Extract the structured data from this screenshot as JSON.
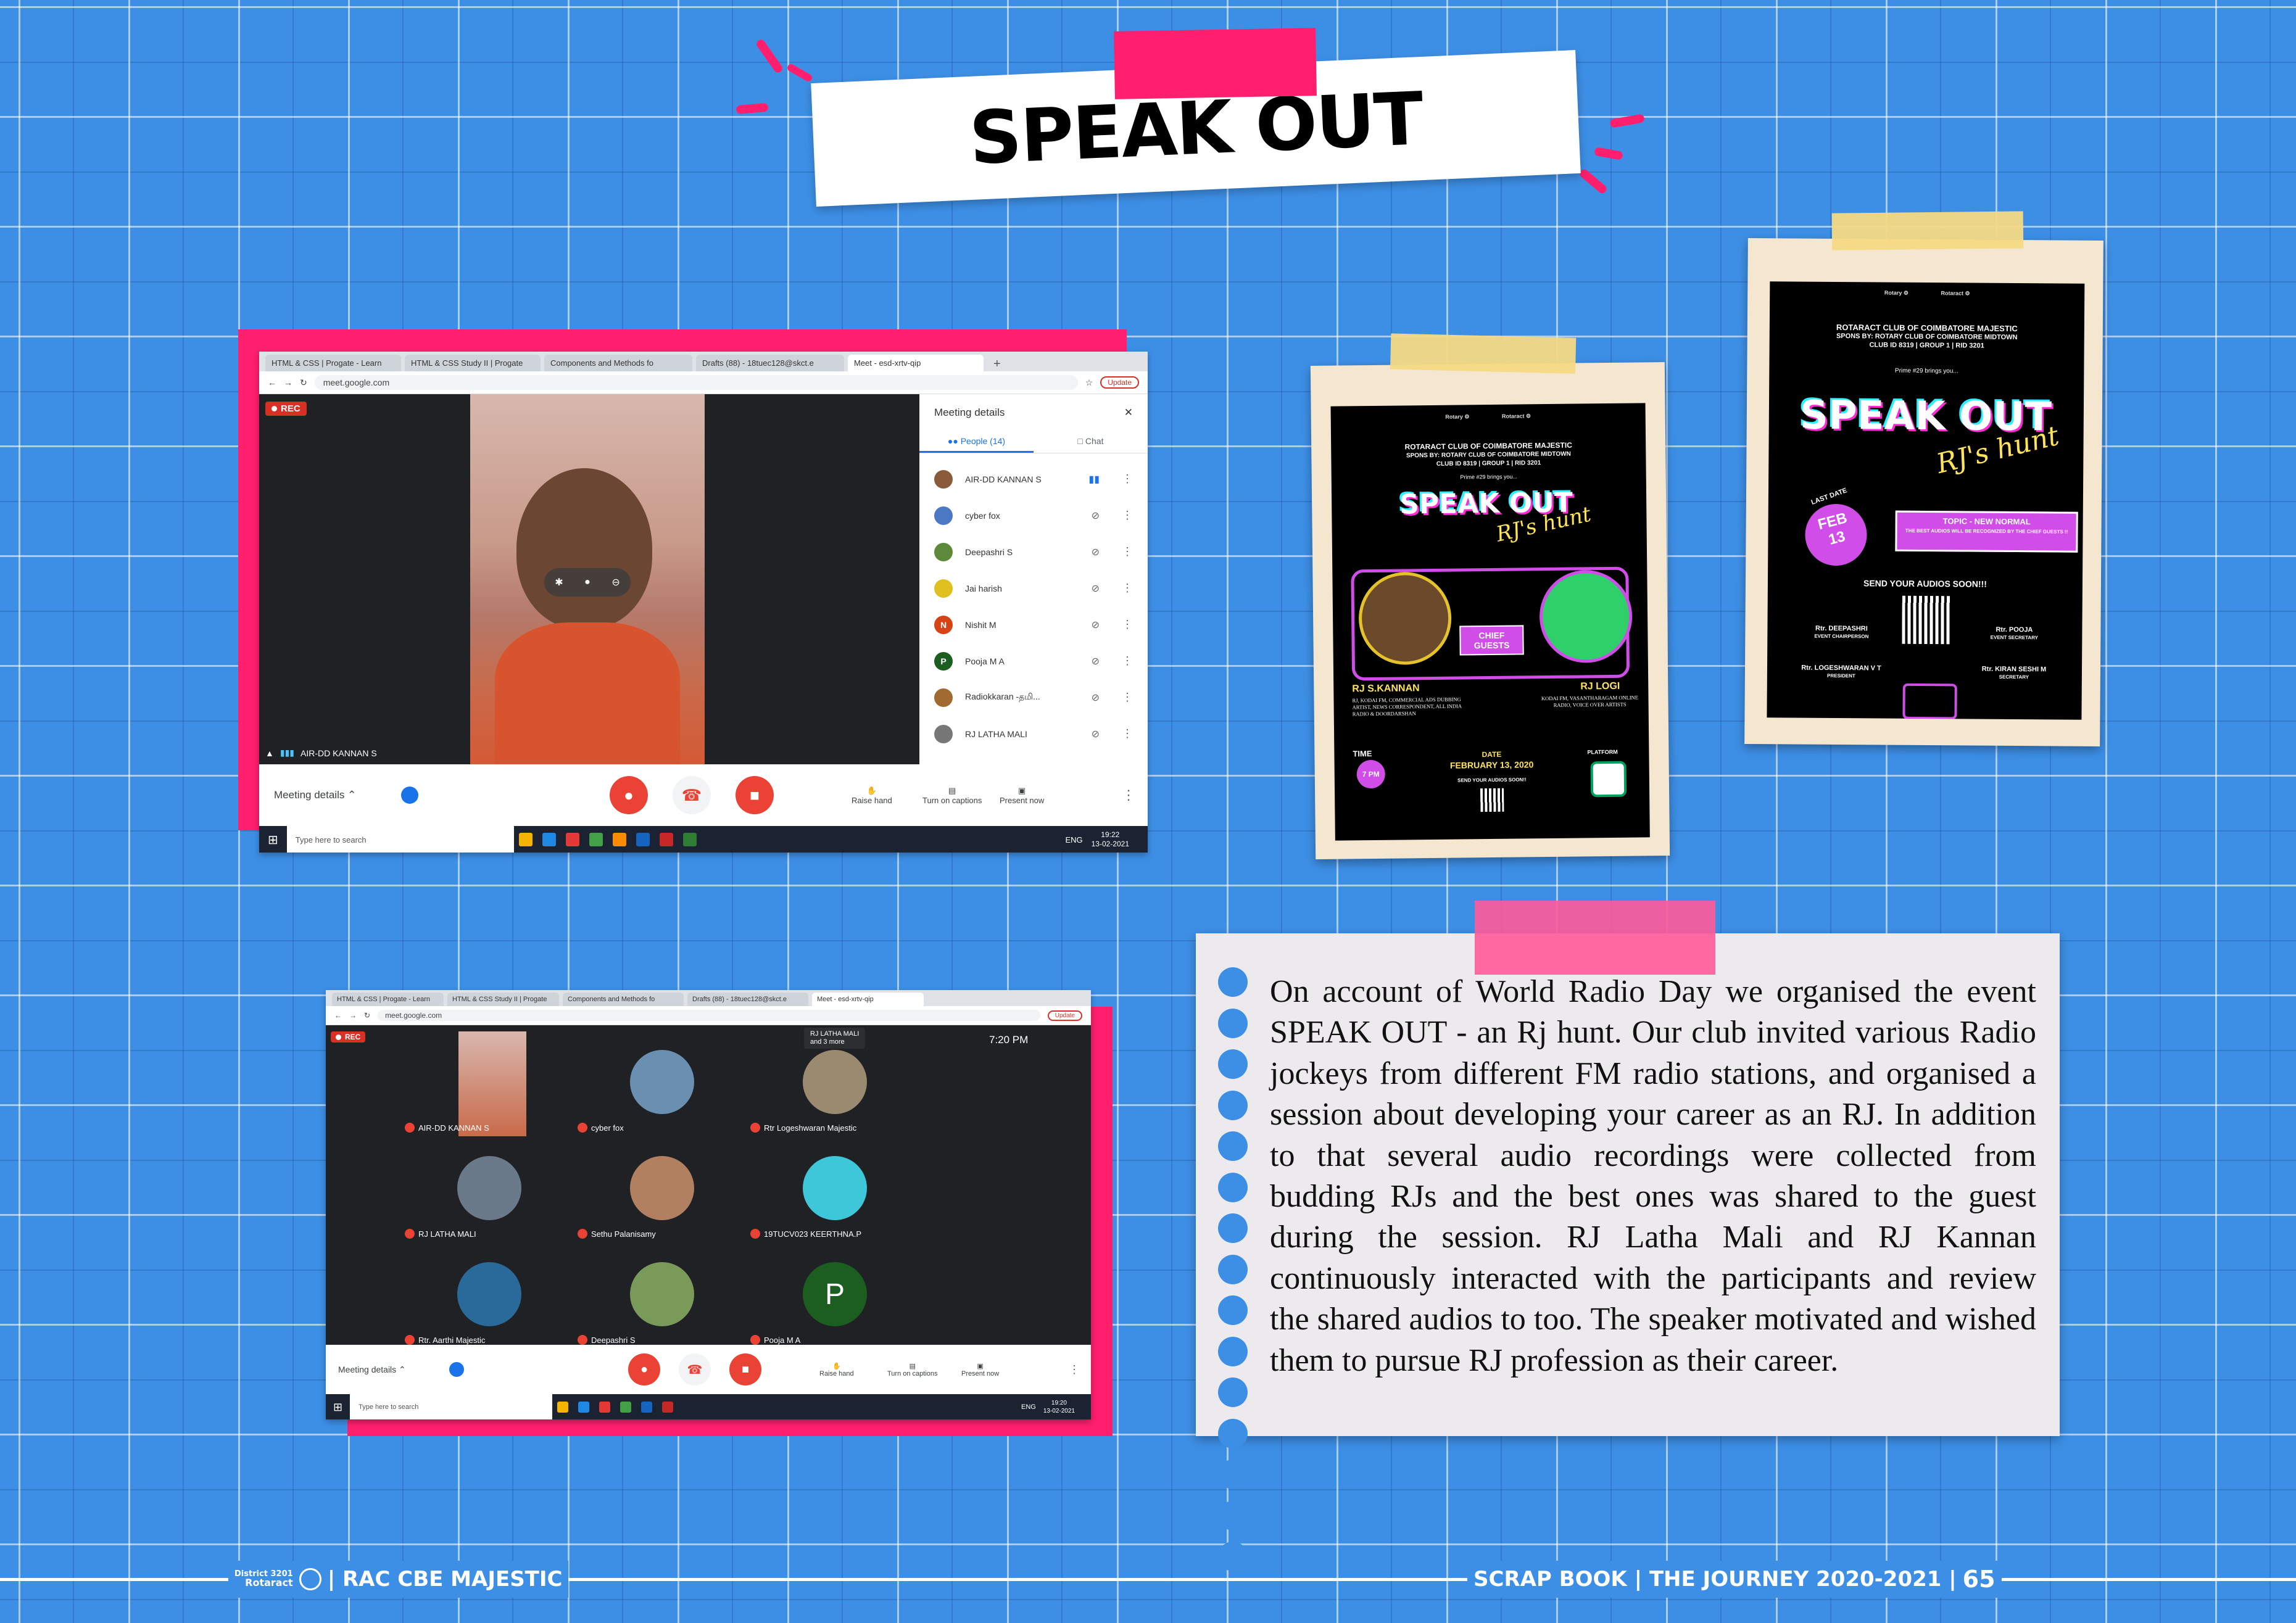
{
  "title": "SPEAK OUT",
  "screenshot1": {
    "tabs": [
      "HTML & CSS | Progate - Learn",
      "HTML & CSS Study II | Progate",
      "Components and Methods fo",
      "Drafts (88) - 18tuec128@skct.e",
      "Meet - esd-xrtv-qip"
    ],
    "url": "meet.google.com",
    "update_label": "Update",
    "rec_label": "REC",
    "speaker_label": "AIR-DD KANNAN S",
    "panel_title": "Meeting details",
    "people_tab": "People (14)",
    "chat_tab": "Chat",
    "participants": [
      {
        "name": "AIR-DD KANNAN S",
        "initial": "",
        "color": "#8a5a3b",
        "speaking": true
      },
      {
        "name": "cyber fox",
        "initial": "",
        "color": "#4a78c2",
        "speaking": false
      },
      {
        "name": "Deepashri S",
        "initial": "",
        "color": "#5c8a3a",
        "speaking": false
      },
      {
        "name": "Jai harish",
        "initial": "",
        "color": "#e0c020",
        "speaking": false
      },
      {
        "name": "Nishit M",
        "initial": "N",
        "color": "#d84315",
        "speaking": false
      },
      {
        "name": "Pooja M A",
        "initial": "P",
        "color": "#1b5e20",
        "speaking": false
      },
      {
        "name": "Radiokkaran -தமி...",
        "initial": "",
        "color": "#a06a30",
        "speaking": false
      },
      {
        "name": "RJ LATHA MALI",
        "initial": "",
        "color": "#777777",
        "speaking": false
      }
    ],
    "meeting_details": "Meeting details",
    "raise_hand": "Raise hand",
    "captions": "Turn on captions",
    "present": "Present now",
    "search_placeholder": "Type here to search",
    "tray_lang": "ENG",
    "tray_time": "19:22",
    "tray_date": "13-02-2021"
  },
  "screenshot2": {
    "tabs": [
      "HTML & CSS | Progate - Learn",
      "HTML & CSS Study II | Progate",
      "Components and Methods fo",
      "Drafts (88) - 18tuec128@skct.e",
      "Meet - esd-xrtv-qip"
    ],
    "url": "meet.google.com",
    "update_label": "Update",
    "rec_label": "REC",
    "presenter_top": "RJ LATHA MALI",
    "presenter_more": "and 3 more",
    "time": "7:20 PM",
    "tiles": [
      {
        "name": "AIR-DD KANNAN S",
        "initial": "",
        "color": "#c86a4a"
      },
      {
        "name": "cyber fox",
        "initial": "",
        "color": "#6a8fb0"
      },
      {
        "name": "Rtr Logeshwaran Majestic",
        "initial": "",
        "color": "#9a8a70"
      },
      {
        "name": "RJ LATHA MALI",
        "initial": "",
        "color": "#6a7a8a"
      },
      {
        "name": "Sethu Palanisamy",
        "initial": "",
        "color": "#b08060"
      },
      {
        "name": "19TUCV023 KEERTHNA.P",
        "initial": "",
        "color": "#3ec7d8"
      },
      {
        "name": "Rtr. Aarthi Majestic",
        "initial": "",
        "color": "#2a6a9a"
      },
      {
        "name": "Deepashri S",
        "initial": "",
        "color": "#7a9a5a"
      },
      {
        "name": "Pooja M A",
        "initial": "P",
        "color": "#1b5e20"
      }
    ],
    "meeting_details": "Meeting details",
    "raise_hand": "Raise hand",
    "captions": "Turn on captions",
    "present": "Present now",
    "search_placeholder": "Type here to search",
    "tray_lang": "ENG",
    "tray_time": "19:20",
    "tray_date": "13-02-2021"
  },
  "poster1": {
    "club": "ROTARACT CLUB OF COIMBATORE MAJESTIC",
    "spons": "SPONS BY: ROTARY CLUB OF COIMBATORE MIDTOWN",
    "club_id": "CLUB ID 8319 | GROUP 1 | RID 3201",
    "prime": "Prime #29 brings you...",
    "title": "SPEAK OUT",
    "script": "RJ's hunt",
    "chief": "CHIEF GUESTS",
    "guest1_name": "RJ S.KANNAN",
    "guest1_desc": "RJ, KODAI FM, COMMERCIAL ADS DUBBING ARTIST, NEWS CORRESPONDENT, ALL INDIA RADIO & DOORDARSHAN",
    "guest2_name": "RJ LOGI",
    "guest2_desc": "KODAI FM, VASANTHARAGAM ONLINE RADIO, VOICE OVER ARTISTS",
    "time_label": "TIME",
    "time_val": "7 PM",
    "date_label": "DATE",
    "date_val": "FEBRUARY 13, 2020",
    "send": "SEND YOUR AUDIOS SOON!!",
    "platform": "PLATFORM"
  },
  "poster2": {
    "club": "ROTARACT CLUB OF COIMBATORE MAJESTIC",
    "spons": "SPONS BY: ROTARY CLUB OF COIMBATORE MIDTOWN",
    "club_id": "CLUB ID 8319 | GROUP 1 | RID 3201",
    "prime": "Prime #29 brings you...",
    "title": "SPEAK OUT",
    "script": "RJ's hunt",
    "last_date": "LAST DATE",
    "feb": "FEB",
    "day": "13",
    "topic": "TOPIC - NEW NORMAL",
    "topic_sub": "THE BEST AUDIOS WILL BE RECOGNIZED BY THE CHIEF GUESTS !!",
    "send": "SEND YOUR AUDIOS SOON!!!",
    "p1_name": "Rtr. DEEPASHRI",
    "p1_role": "EVENT CHAIRPERSON",
    "p2_name": "Rtr. POOJA",
    "p2_role": "EVENT SECRETARY",
    "p3_name": "Rtr. LOGESHWARAN V T",
    "p3_role": "PRESIDENT",
    "p4_name": "Rtr. KIRAN SESHI M",
    "p4_role": "SECRETARY"
  },
  "description": "On account of World Radio Day we organised  the event SPEAK OUT - an Rj hunt. Our club invited various Radio jockeys from different FM radio stations, and organised a session about developing your career as an RJ. In addition to that several audio recordings were collected from budding RJs  and the best ones was shared to the guest during the session. RJ Latha Mali and RJ Kannan continuously interacted with the participants and review the shared audios to too. The speaker motivated and wished them to pursue RJ profession as their career.",
  "footer": {
    "district": "District 3201",
    "rotaract": "Rotaract",
    "club": "| RAC CBE MAJESTIC",
    "book": "SCRAP BOOK | THE JOURNEY 2020-2021 |",
    "page": "65"
  },
  "colors": {
    "accent_pink": "#ff1f6d",
    "background_blue": "#3d8fe6"
  }
}
